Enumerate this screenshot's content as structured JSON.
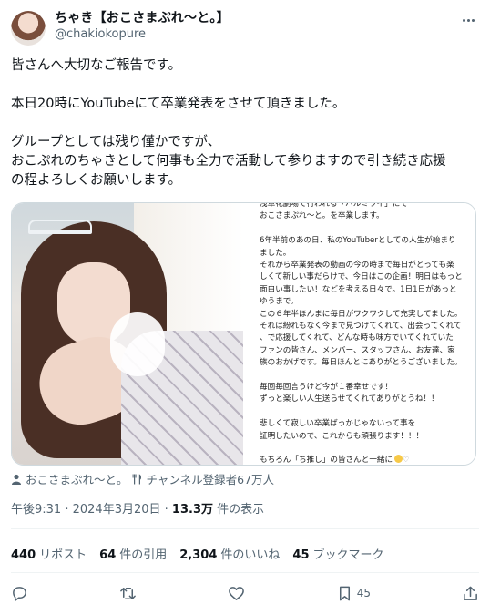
{
  "tweet": {
    "display_name": "ちゃき【おこさまぷれ〜と。】",
    "handle": "@chakiokopure",
    "body_lines": [
      "皆さんへ大切なご報告です。",
      "",
      "本日20時にYouTubeにて卒業発表をさせて頂きました。",
      "",
      "グループとしては残り僅かですが、",
      "おこぷれのちゃきとして何事も全力で活動して参りますので引き続き応援",
      "の程よろしくお願いします。"
    ]
  },
  "image_note": {
    "lines": [
      "浅草花劇場で行われる「ハルミライ」にて",
      "おこさまぷれ〜と。を卒業します。",
      "",
      "6年半前のあの日、私のYouTuberとしての人生が始まり",
      "ました。",
      "それから卒業発表の動画の今の時まで毎日がとっても楽",
      "しくて新しい事だらけで、今日はこの企画！明日はもっと",
      "面白い事したい！などを考える日々で。1日1日があっと",
      "ゆうまで。",
      "この６年半ほんまに毎日がワクワクして充実してました。",
      "それは紛れもなく今まで見つけてくれて、出会ってくれて",
      "、で応援してくれて、どんな時も味方でいてくれていた",
      "ファンの皆さん、メンバー、スタッフさん、お友達、家",
      "族のおかげです。毎日ほんとにありがとうございました。",
      "",
      "毎回毎回言うけど今が１番幸せです！",
      "ずっと楽しい人生送らせてくれてありがとうね！！",
      "",
      "悲しくて寂しい卒業ばっかじゃないって事を",
      "証明したいので、これからも頑張ります！！！",
      "",
      "もちろん「ち推し」の皆さんと一緒に"
    ]
  },
  "labels": {
    "channel": "おこさまぷれ〜と。",
    "subscribers": "チャンネル登録者67万人"
  },
  "meta": {
    "time": "午後9:31",
    "separator": " · ",
    "date": "2024年3月20日",
    "views_count": "13.3万",
    "views_label": "件の表示"
  },
  "stats": {
    "reposts_count": "440",
    "reposts_label": "リポスト",
    "quotes_count": "64",
    "quotes_label": "件の引用",
    "likes_count": "2,304",
    "likes_label": "件のいいね",
    "bookmarks_count": "45",
    "bookmarks_label": "ブックマーク"
  },
  "actions": {
    "bookmark_count": "45"
  },
  "colors": {
    "text": "#0f1419",
    "secondary": "#536471",
    "border": "#cfd9de"
  },
  "icons": [
    "more-icon",
    "person-icon",
    "fork-knife-icon",
    "reply-icon",
    "repost-icon",
    "like-icon",
    "bookmark-icon",
    "share-icon"
  ]
}
